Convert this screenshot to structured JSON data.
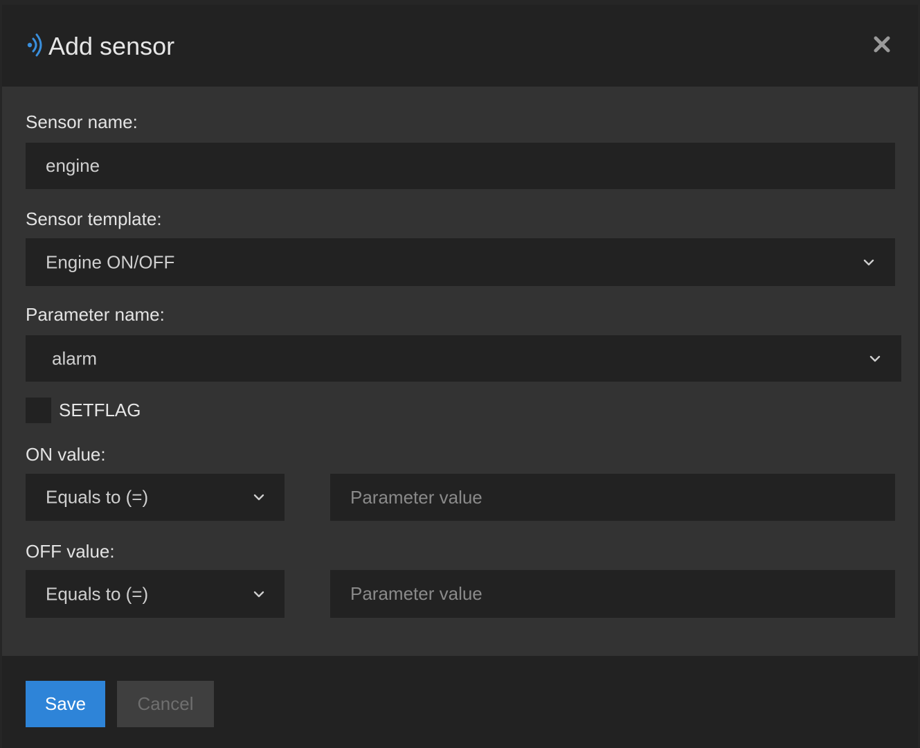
{
  "modal": {
    "title": "Add sensor",
    "icon": "sensor-signal-icon",
    "close_icon": "close-icon",
    "accent_color": "#2e84d8"
  },
  "form": {
    "sensor_name": {
      "label": "Sensor name:",
      "value": "engine"
    },
    "sensor_template": {
      "label": "Sensor template:",
      "selected": "Engine ON/OFF"
    },
    "parameter_name": {
      "label": "Parameter name:",
      "selected": "alarm"
    },
    "setflag": {
      "label": "SETFLAG",
      "checked": false
    },
    "on_value": {
      "label": "ON value:",
      "operator": "Equals to (=)",
      "placeholder": "Parameter value"
    },
    "off_value": {
      "label": "OFF value:",
      "operator": "Equals to (=)",
      "placeholder": "Parameter value"
    }
  },
  "footer": {
    "save_label": "Save",
    "cancel_label": "Cancel"
  }
}
